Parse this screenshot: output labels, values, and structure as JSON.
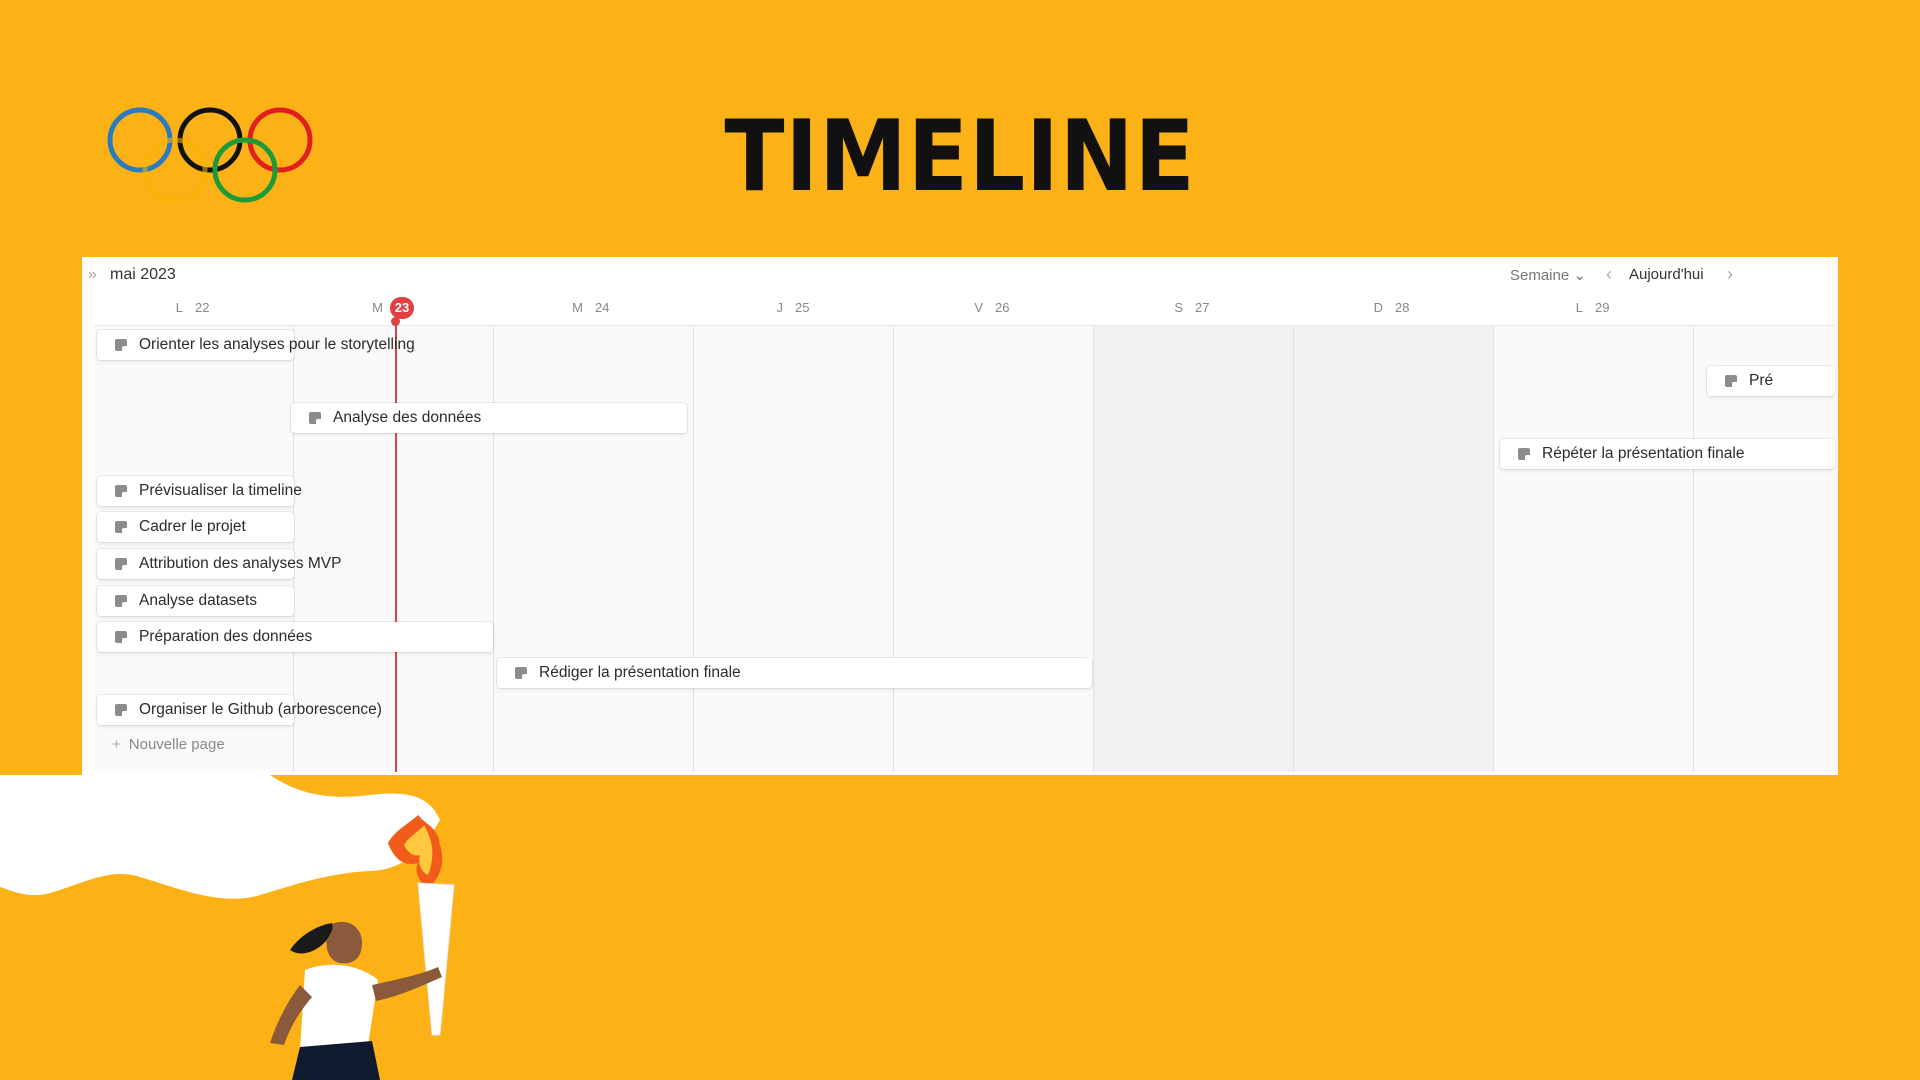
{
  "slide": {
    "title": "TIMELINE",
    "colors": {
      "background": "#FCB216",
      "ring_blue": "#2B7BBF",
      "ring_black": "#111111",
      "ring_red": "#E02020",
      "ring_yellow": "#F4B400",
      "ring_green": "#1E9A3A",
      "today": "#D94545"
    }
  },
  "timeline": {
    "month": "mai 2023",
    "collapse_icon": "chevrons-right-icon",
    "view": "Semaine",
    "view_icon": "chevron-down-icon",
    "today_label": "Aujourd'hui",
    "days": [
      {
        "letter": "L",
        "number": "22",
        "today": false,
        "weekend": false
      },
      {
        "letter": "M",
        "number": "23",
        "today": true,
        "weekend": false
      },
      {
        "letter": "M",
        "number": "24",
        "today": false,
        "weekend": false
      },
      {
        "letter": "J",
        "number": "25",
        "today": false,
        "weekend": false
      },
      {
        "letter": "V",
        "number": "26",
        "today": false,
        "weekend": false
      },
      {
        "letter": "S",
        "number": "27",
        "today": false,
        "weekend": true
      },
      {
        "letter": "D",
        "number": "28",
        "today": false,
        "weekend": true
      },
      {
        "letter": "L",
        "number": "29",
        "today": false,
        "weekend": false
      },
      {
        "letter": "",
        "number": "",
        "today": false,
        "weekend": false
      }
    ],
    "tasks": [
      {
        "label": "Orienter les analyses pour le storytelling"
      },
      {
        "label": "Analyse des données"
      },
      {
        "label": "Répéter la présentation finale"
      },
      {
        "label": "Pré"
      },
      {
        "label": "Prévisualiser la timeline"
      },
      {
        "label": "Cadrer le projet"
      },
      {
        "label": "Attribution des analyses MVP"
      },
      {
        "label": "Analyse datasets"
      },
      {
        "label": "Préparation des données"
      },
      {
        "label": "Rédiger la présentation finale"
      },
      {
        "label": "Organiser le Github (arborescence)"
      }
    ],
    "new_page": "Nouvelle page"
  }
}
